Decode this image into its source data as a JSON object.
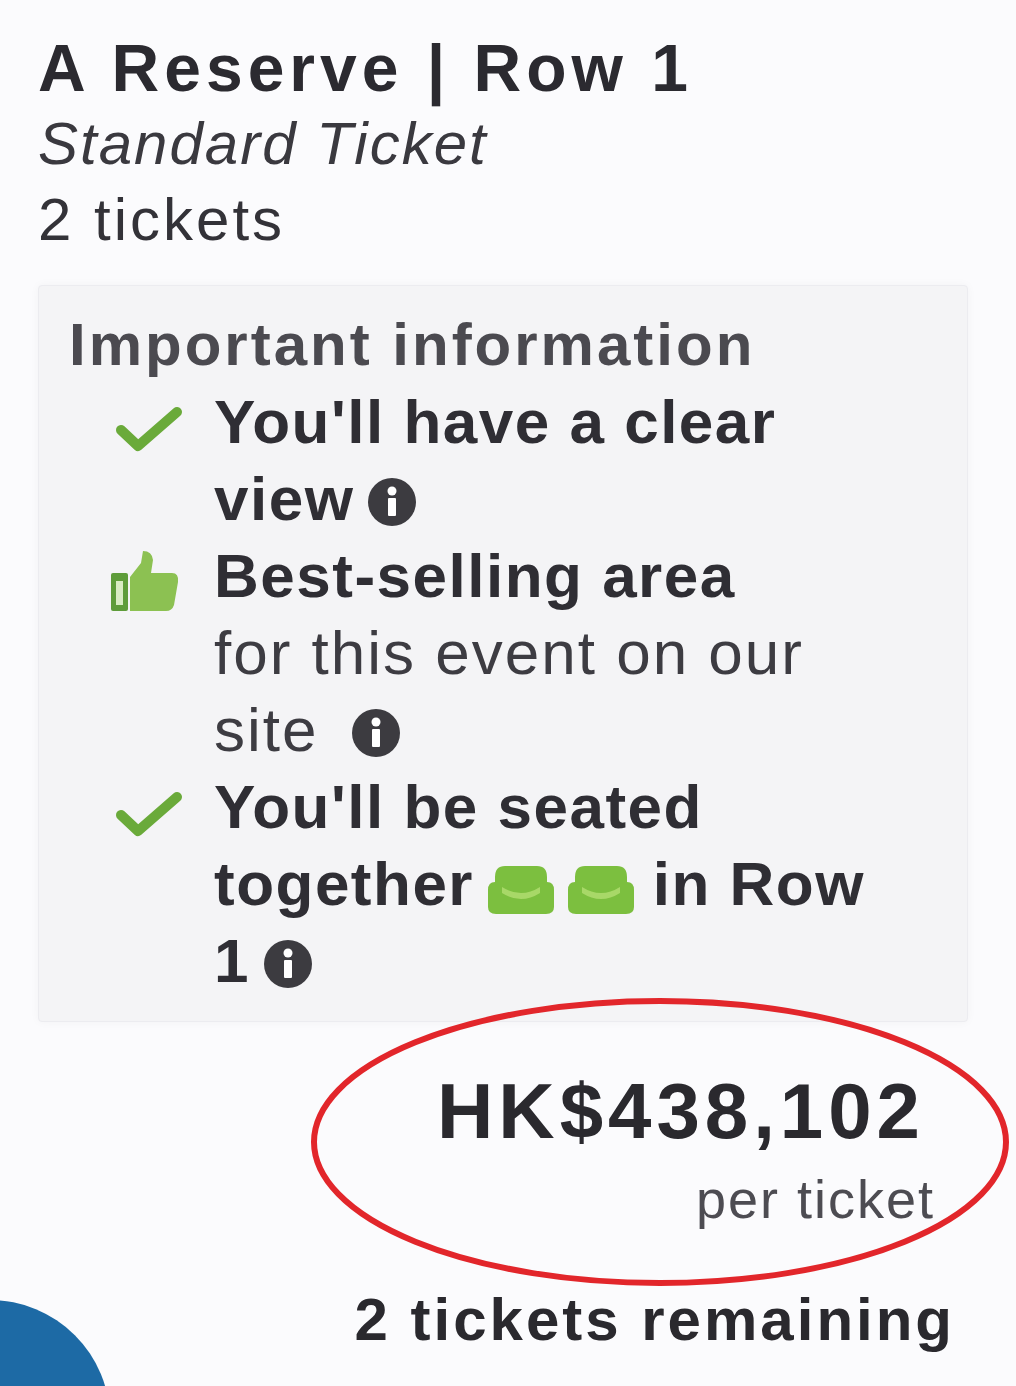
{
  "listing": {
    "title": "A Reserve | Row 1",
    "ticket_type": "Standard Ticket",
    "quantity": "2 tickets"
  },
  "info_panel": {
    "heading": "Important information",
    "items": [
      {
        "kind": "check",
        "text": "You'll have a clear view",
        "info": true
      },
      {
        "kind": "thumb",
        "text": "Best-selling area",
        "note": "for this event on our site",
        "info": true
      },
      {
        "kind": "check",
        "text": "You'll be seated together",
        "seat_icons": true,
        "text_after": "in Row 1",
        "info": true
      }
    ]
  },
  "price": {
    "amount": "HK$438,102",
    "unit": "per ticket",
    "highlighted": true
  },
  "remaining": "2 tickets remaining"
}
